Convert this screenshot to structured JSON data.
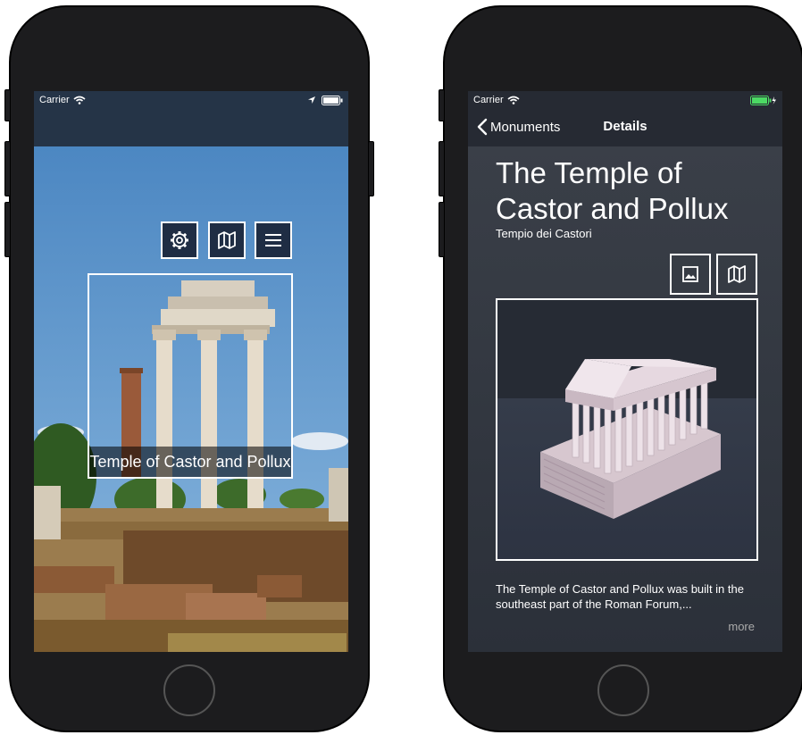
{
  "left_phone": {
    "status": {
      "carrier": "Carrier"
    },
    "buttons": {
      "settings_icon": "gear-icon",
      "map_icon": "map-icon",
      "menu_icon": "hamburger-icon"
    },
    "ar_label": "Temple of Castor and Pollux"
  },
  "right_phone": {
    "status": {
      "carrier": "Carrier"
    },
    "navbar": {
      "back_label": "Monuments",
      "title": "Details"
    },
    "monument": {
      "title": "The Temple of Castor and Pollux",
      "subtitle": "Tempio dei Castori",
      "description": "The Temple of Castor and Pollux was built in the southeast part of the Roman Forum,...",
      "more_label": "more"
    },
    "buttons": {
      "image_icon": "image-icon",
      "map_icon": "map-icon"
    }
  },
  "colors": {
    "nav_dark": "#253447",
    "detail_bg": "#262a33",
    "button_bg": "#1f2d44",
    "battery_green": "#4cd964"
  }
}
